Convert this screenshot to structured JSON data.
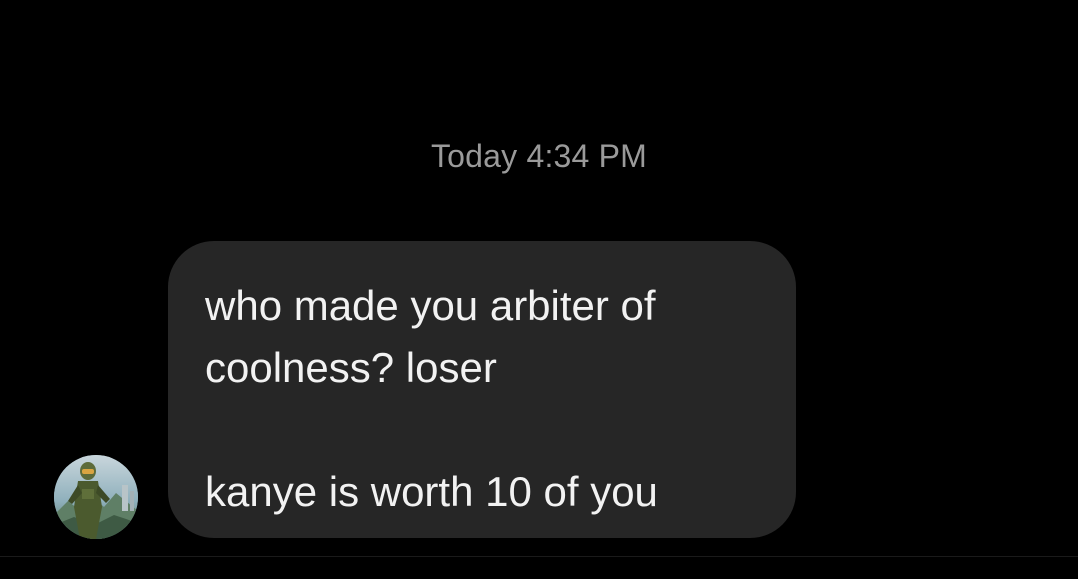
{
  "conversation": {
    "timestamp": "Today 4:34 PM",
    "message": {
      "lines": [
        "who made you arbiter of",
        "coolness? loser",
        "",
        "kanye is worth 10 of you"
      ]
    }
  },
  "colors": {
    "background": "#000000",
    "bubble": "#262626",
    "message_text": "#f2f2f2",
    "timestamp_text": "#9a9a9a"
  },
  "icons": {
    "avatar": "profile-photo-armored-soldier"
  }
}
